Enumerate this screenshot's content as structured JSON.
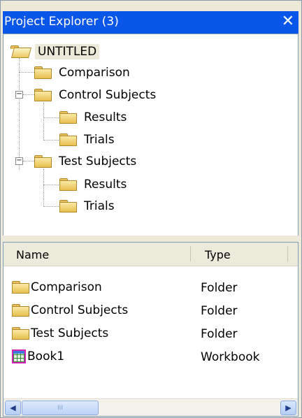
{
  "panel": {
    "title": "Project Explorer (3)",
    "close_glyph": "✕"
  },
  "tree": {
    "root": "UNTITLED",
    "comparison": "Comparison",
    "control": "Control Subjects",
    "control_results": "Results",
    "control_trials": "Trials",
    "test": "Test Subjects",
    "test_results": "Results",
    "test_trials": "Trials",
    "expander_collapse": "−"
  },
  "list": {
    "columns": [
      "Name",
      "Type"
    ],
    "rows": [
      {
        "name": "Comparison",
        "type": "Folder",
        "icon": "folder-icon"
      },
      {
        "name": "Control Subjects",
        "type": "Folder",
        "icon": "folder-icon"
      },
      {
        "name": "Test Subjects",
        "type": "Folder",
        "icon": "folder-icon"
      },
      {
        "name": "Book1",
        "type": "Workbook",
        "icon": "workbook-icon"
      }
    ]
  },
  "scrollbar": {
    "left_arrow": "◀",
    "right_arrow": "▶",
    "grip": "III"
  }
}
